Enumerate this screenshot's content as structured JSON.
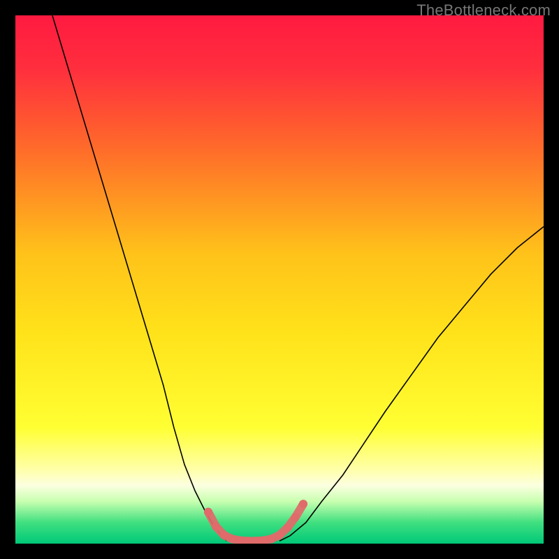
{
  "watermark": "TheBottleneck.com",
  "chart_data": {
    "type": "line",
    "title": "",
    "xlabel": "",
    "ylabel": "",
    "xlim": [
      0,
      100
    ],
    "ylim": [
      0,
      100
    ],
    "background_gradient": {
      "stops": [
        {
          "offset": 0.0,
          "color": "#ff1a40"
        },
        {
          "offset": 0.1,
          "color": "#ff2e3e"
        },
        {
          "offset": 0.25,
          "color": "#ff6a2a"
        },
        {
          "offset": 0.45,
          "color": "#ffc21a"
        },
        {
          "offset": 0.6,
          "color": "#ffe21a"
        },
        {
          "offset": 0.78,
          "color": "#ffff33"
        },
        {
          "offset": 0.86,
          "color": "#ffffaa"
        },
        {
          "offset": 0.89,
          "color": "#fbffe0"
        },
        {
          "offset": 0.92,
          "color": "#c8ffb0"
        },
        {
          "offset": 0.96,
          "color": "#40e080"
        },
        {
          "offset": 1.0,
          "color": "#00c878"
        }
      ]
    },
    "series": [
      {
        "name": "left-curve",
        "color": "#000000",
        "width": 1.6,
        "x": [
          7,
          10,
          13,
          16,
          19,
          22,
          25,
          28,
          30,
          32,
          34,
          36,
          37.5,
          39,
          40
        ],
        "y": [
          100,
          90,
          80,
          70,
          60,
          50,
          40,
          30,
          22,
          15,
          10,
          6,
          3.5,
          1.5,
          0.5
        ]
      },
      {
        "name": "right-curve",
        "color": "#000000",
        "width": 1.6,
        "x": [
          50,
          52,
          55,
          58,
          62,
          66,
          70,
          75,
          80,
          85,
          90,
          95,
          100
        ],
        "y": [
          0.5,
          1.5,
          4,
          8,
          13,
          19,
          25,
          32,
          39,
          45,
          51,
          56,
          60
        ]
      },
      {
        "name": "highlight-band",
        "type": "marker",
        "color": "#e16a6a",
        "radius": 6,
        "x": [
          36.5,
          38,
          39.5,
          41,
          42.5,
          44,
          45.5,
          47,
          48.5,
          50,
          51.5,
          53,
          54.5
        ],
        "y": [
          6.0,
          3.2,
          1.6,
          0.9,
          0.6,
          0.5,
          0.5,
          0.6,
          0.9,
          1.6,
          3.0,
          5.0,
          7.5
        ]
      }
    ]
  }
}
